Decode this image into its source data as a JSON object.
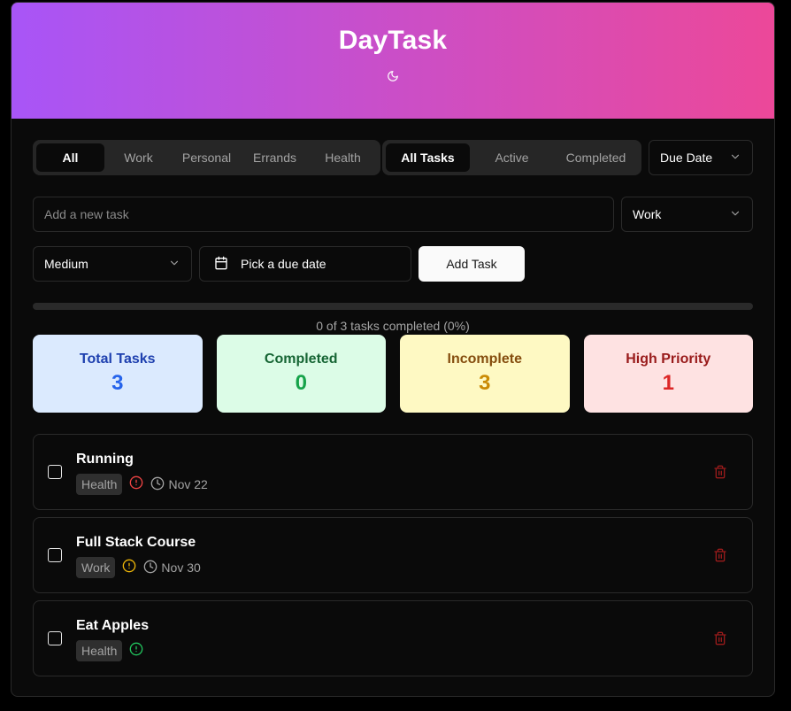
{
  "app": {
    "title": "DayTask"
  },
  "filters": {
    "categories": [
      "All",
      "Work",
      "Personal",
      "Errands",
      "Health"
    ],
    "active_category": "All",
    "statuses": [
      "All Tasks",
      "Active",
      "Completed"
    ],
    "active_status": "All Tasks",
    "sort": "Due Date"
  },
  "new_task": {
    "placeholder": "Add a new task",
    "category": "Work",
    "priority": "Medium",
    "date_label": "Pick a due date",
    "add_label": "Add Task"
  },
  "progress": {
    "fraction": 0,
    "text": "0 of 3 tasks completed (0%)"
  },
  "stats": {
    "total": {
      "label": "Total Tasks",
      "value": "3"
    },
    "completed": {
      "label": "Completed",
      "value": "0"
    },
    "incomplete": {
      "label": "Incomplete",
      "value": "3"
    },
    "high": {
      "label": "High Priority",
      "value": "1"
    }
  },
  "tasks": [
    {
      "title": "Running",
      "category": "Health",
      "priority": "high",
      "due": "Nov 22"
    },
    {
      "title": "Full Stack Course",
      "category": "Work",
      "priority": "medium",
      "due": "Nov 30"
    },
    {
      "title": "Eat Apples",
      "category": "Health",
      "priority": "low",
      "due": ""
    }
  ],
  "colors": {
    "high": "#ef4444",
    "medium": "#eab308",
    "low": "#22c55e",
    "trash": "#991b1b"
  },
  "icons": {
    "theme": "moon-icon",
    "chevron": "chevron-down-icon",
    "calendar": "calendar-icon",
    "priority": "alert-circle-icon",
    "due": "clock-icon",
    "delete": "trash-icon"
  }
}
